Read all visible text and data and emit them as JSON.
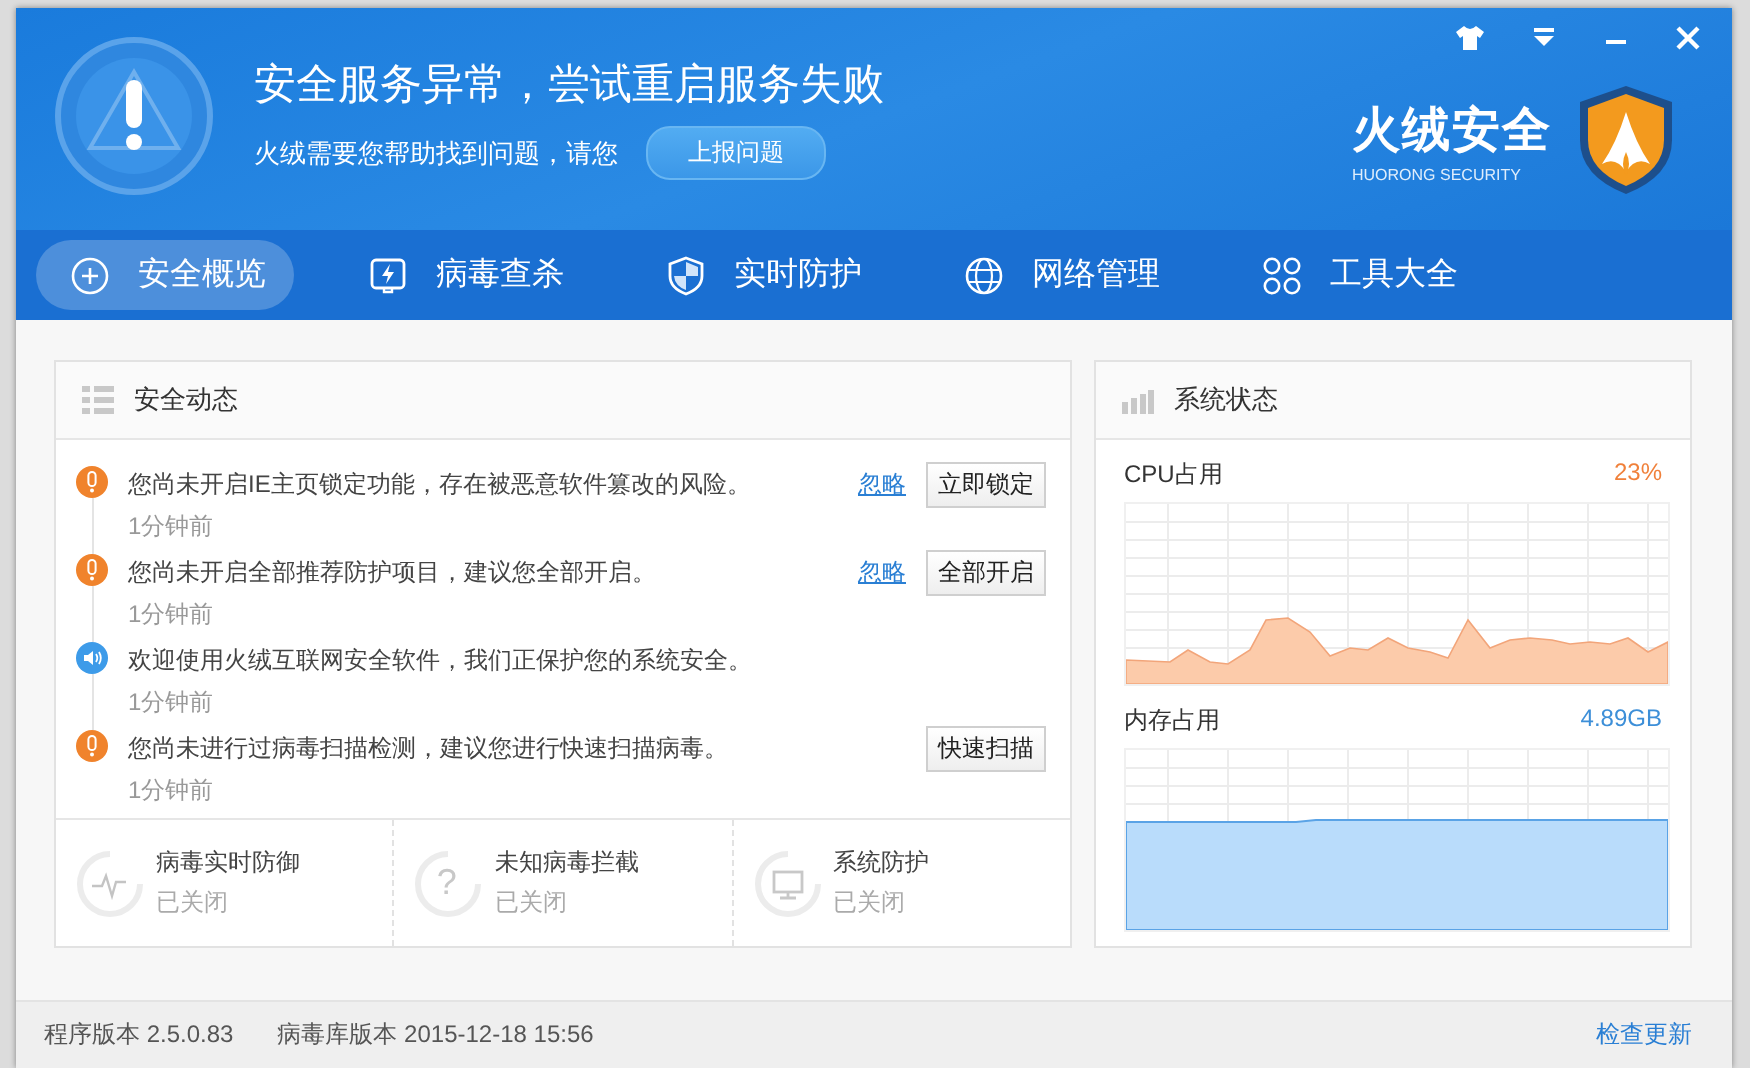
{
  "window": {
    "title": "安全服务异常，尝试重启服务失败",
    "subtitle": "火绒需要您帮助找到问题，请您",
    "report_button": "上报问题",
    "brand": "火绒安全",
    "brand_en": "HUORONG SECURITY"
  },
  "tabs": [
    {
      "label": "安全概览",
      "selected": true
    },
    {
      "label": "病毒查杀",
      "selected": false
    },
    {
      "label": "实时防护",
      "selected": false
    },
    {
      "label": "网络管理",
      "selected": false
    },
    {
      "label": "工具大全",
      "selected": false
    }
  ],
  "events": {
    "title": "安全动态",
    "items": [
      {
        "kind": "warning",
        "text": "您尚未开启IE主页锁定功能，存在被恶意软件篡改的风险。",
        "time": "1分钟前",
        "ignore": "忽略",
        "action": "立即锁定"
      },
      {
        "kind": "warning",
        "text": "您尚未开启全部推荐防护项目，建议您全部开启。",
        "time": "1分钟前",
        "ignore": "忽略",
        "action": "全部开启"
      },
      {
        "kind": "info",
        "text": "欢迎使用火绒互联网安全软件，我们正保护您的系统安全。",
        "time": "1分钟前"
      },
      {
        "kind": "warning",
        "text": "您尚未进行过病毒扫描检测，建议您进行快速扫描病毒。",
        "time": "1分钟前",
        "action": "快速扫描"
      }
    ],
    "protections": [
      {
        "name": "病毒实时防御",
        "state": "已关闭"
      },
      {
        "icon_text": "?",
        "name": "未知病毒拦截",
        "state": "已关闭"
      },
      {
        "name": "系统防护",
        "state": "已关闭"
      }
    ]
  },
  "system": {
    "title": "系统状态",
    "meters": [
      {
        "kind": "cpu",
        "label": "CPU占用",
        "reading": "23%"
      },
      {
        "kind": "memory",
        "label": "内存占用",
        "reading": "4.89GB"
      }
    ]
  },
  "status_bar": {
    "version": "程序版本 2.5.0.83",
    "db_version": "病毒库版本 2015-12-18 15:56",
    "update_link": "检查更新"
  }
}
